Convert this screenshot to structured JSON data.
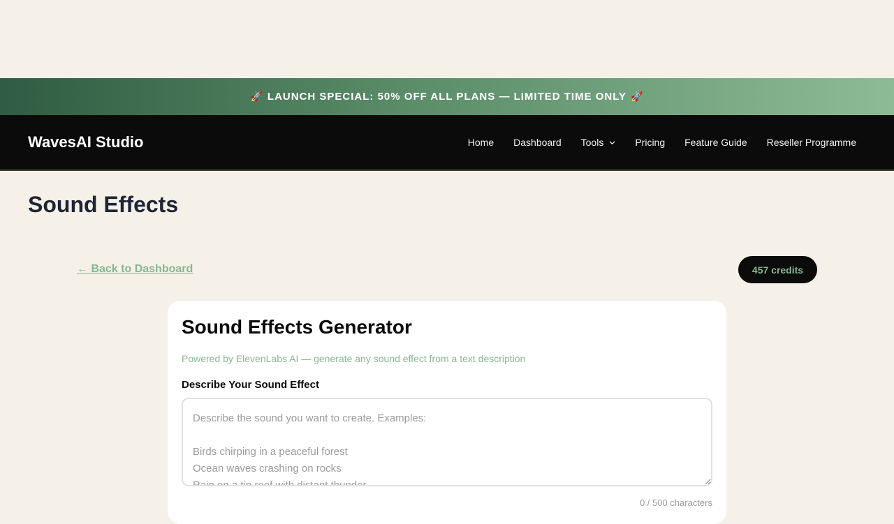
{
  "promo": {
    "icon_left": "rocket-icon",
    "icon_right": "rocket-icon",
    "text": "LAUNCH SPECIAL: 50% OFF ALL PLANS — LIMITED TIME ONLY"
  },
  "nav": {
    "brand": "WavesAI Studio",
    "links": {
      "home": "Home",
      "dashboard": "Dashboard",
      "tools": "Tools",
      "pricing": "Pricing",
      "feature_guide": "Feature Guide",
      "reseller": "Reseller Programme"
    },
    "tools_icon": "chevron-down-icon"
  },
  "page": {
    "title": "Sound Effects",
    "back_link": "← Back to Dashboard",
    "credits": "457 credits"
  },
  "generator": {
    "title": "Sound Effects Generator",
    "subtitle": "Powered by ElevenLabs AI — generate any sound effect from a text description",
    "field_label": "Describe Your Sound Effect",
    "placeholder": "Describe the sound you want to create. Examples:\n\nBirds chirping in a peaceful forest\nOcean waves crashing on rocks\nRain on a tin roof with distant thunder",
    "value": "",
    "char_count": "0 / 500 characters"
  },
  "colors": {
    "background": "#f5f0e8",
    "navbar": "#0b0b0b",
    "accent_green": "#85b88f",
    "title_navy": "#1e2535",
    "promo_start": "#2f5c42",
    "promo_end": "#8dbb95"
  }
}
